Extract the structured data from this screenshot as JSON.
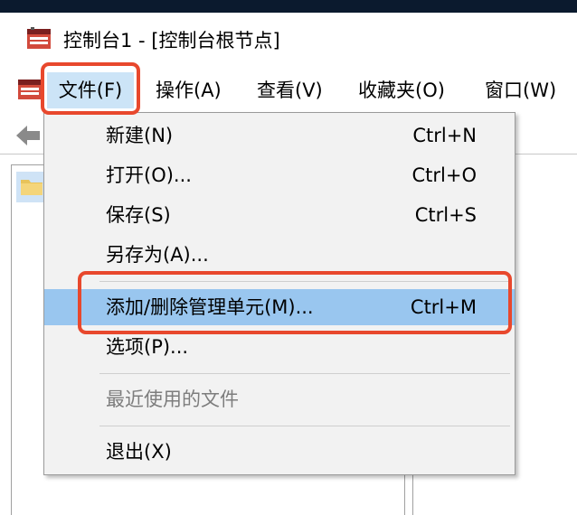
{
  "window": {
    "title": "控制台1 - [控制台根节点]"
  },
  "menubar": {
    "items": [
      "文件(F)",
      "操作(A)",
      "查看(V)",
      "收藏夹(O)",
      "窗口(W)"
    ]
  },
  "file_menu": {
    "items": [
      {
        "label": "新建(N)",
        "shortcut": "Ctrl+N"
      },
      {
        "label": "打开(O)...",
        "shortcut": "Ctrl+O"
      },
      {
        "label": "保存(S)",
        "shortcut": "Ctrl+S"
      },
      {
        "label": "另存为(A)...",
        "shortcut": ""
      },
      {
        "label": "添加/删除管理单元(M)...",
        "shortcut": "Ctrl+M"
      },
      {
        "label": "选项(P)...",
        "shortcut": ""
      },
      {
        "label": "最近使用的文件",
        "shortcut": ""
      },
      {
        "label": "退出(X)",
        "shortcut": ""
      }
    ],
    "highlighted_item": "添加/删除管理单元(M)...",
    "disabled_item": "最近使用的文件"
  },
  "colors": {
    "callout": "#e8482d",
    "highlight": "#99c6ef",
    "menu_open": "#cce4f7",
    "screen_background": "#0b1a2e"
  },
  "icons": {
    "app": "mmc-console-icon",
    "back": "back-arrow-icon",
    "tree": "folder-icon"
  }
}
